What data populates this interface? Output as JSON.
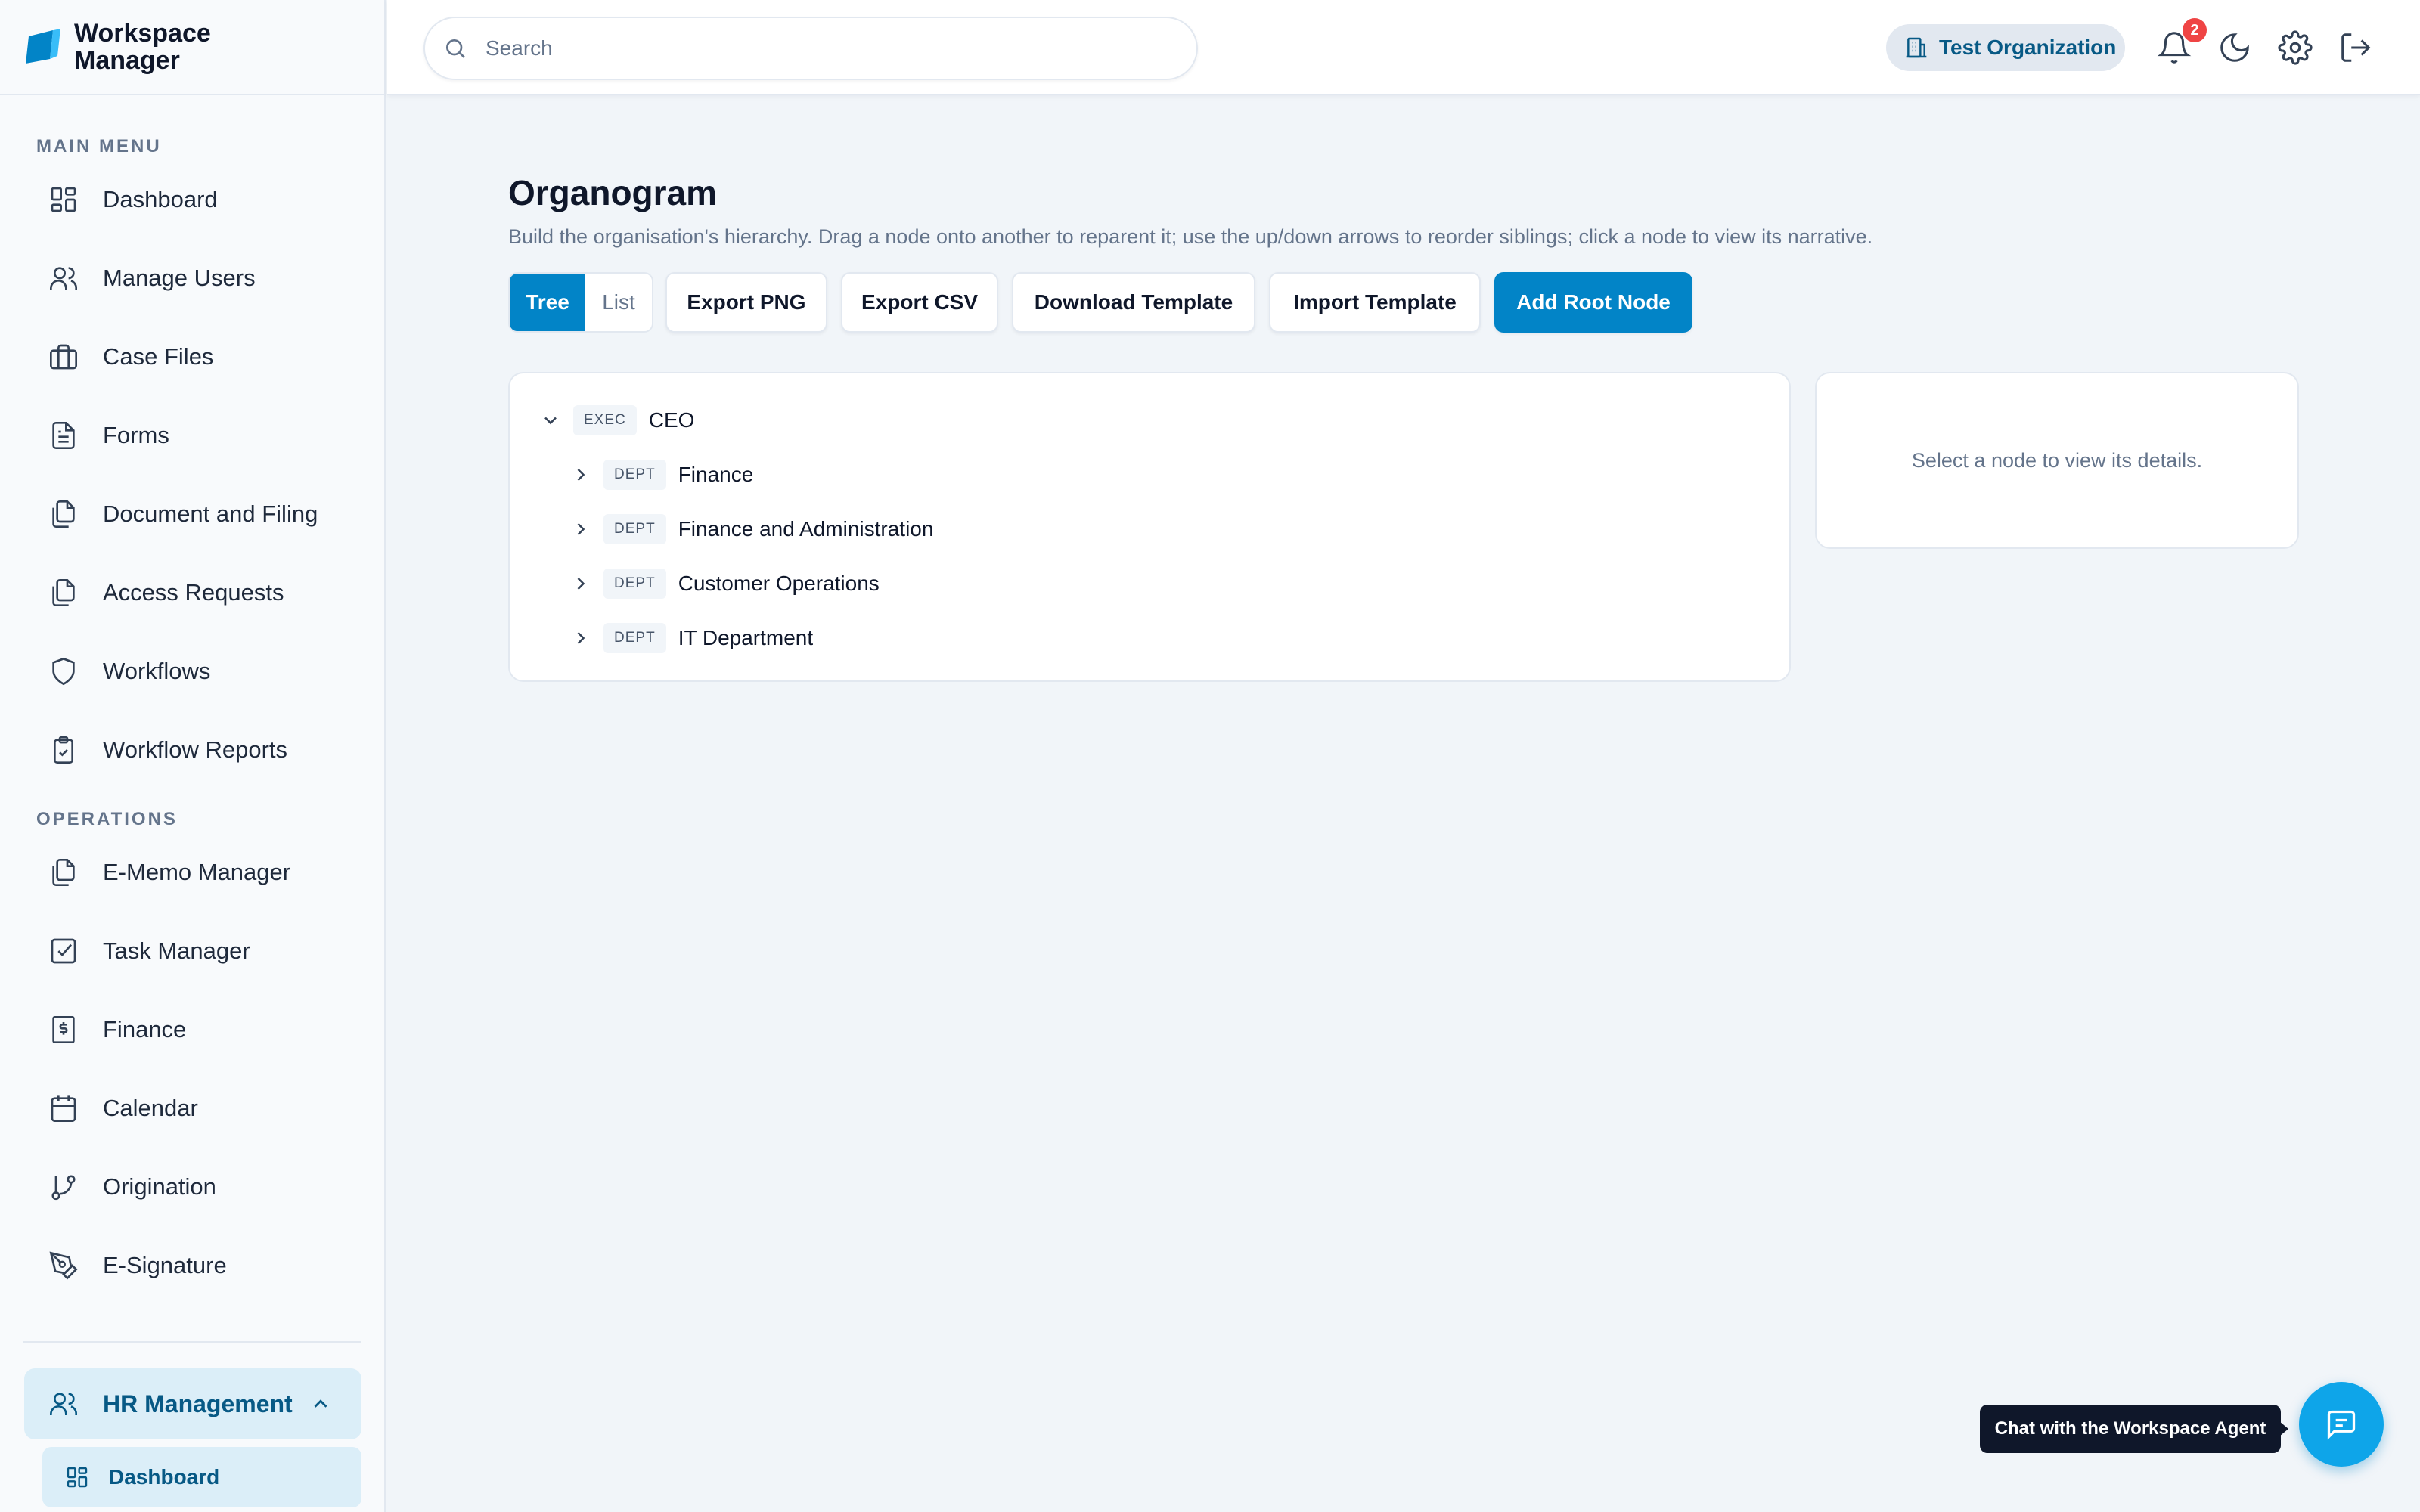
{
  "brand": {
    "line1": "Workspace",
    "line2": "Manager",
    "accent": "#0284c7"
  },
  "sidebar": {
    "main_label": "MAIN MENU",
    "main_items": [
      {
        "label": "Dashboard",
        "icon": "grid-icon"
      },
      {
        "label": "Manage Users",
        "icon": "users-icon"
      },
      {
        "label": "Case Files",
        "icon": "briefcase-icon"
      },
      {
        "label": "Forms",
        "icon": "file-text-icon"
      },
      {
        "label": "Document and Filing",
        "icon": "files-icon"
      },
      {
        "label": "Access Requests",
        "icon": "files-icon"
      },
      {
        "label": "Workflows",
        "icon": "shield-icon"
      },
      {
        "label": "Workflow Reports",
        "icon": "clipboard-check-icon"
      }
    ],
    "ops_label": "OPERATIONS",
    "ops_items": [
      {
        "label": "E-Memo Manager",
        "icon": "files-icon"
      },
      {
        "label": "Task Manager",
        "icon": "square-check-icon"
      },
      {
        "label": "Finance",
        "icon": "dollar-receipt-icon"
      },
      {
        "label": "Calendar",
        "icon": "calendar-icon"
      },
      {
        "label": "Origination",
        "icon": "git-branch-icon"
      },
      {
        "label": "E-Signature",
        "icon": "pen-tool-icon"
      }
    ],
    "hr_group": {
      "label": "HR Management",
      "icon": "users-icon"
    },
    "hr_sub": {
      "label": "Dashboard",
      "icon": "grid-icon"
    }
  },
  "header": {
    "search_placeholder": "Search",
    "org_name": "Test Organization",
    "notification_count": "2"
  },
  "main": {
    "title": "Organogram",
    "description": "Build the organisation's hierarchy. Drag a node onto another to reparent it; use the up/down arrows to reorder siblings; click a node to view its narrative.",
    "view_tree": "Tree",
    "view_list": "List",
    "export_png": "Export PNG",
    "export_csv": "Export CSV",
    "download_template": "Download Template",
    "import_template": "Import Template",
    "add_root": "Add Root Node",
    "tree": {
      "root": {
        "tag": "EXEC",
        "label": "CEO"
      },
      "children": [
        {
          "tag": "DEPT",
          "label": "Finance"
        },
        {
          "tag": "DEPT",
          "label": "Finance and Administration"
        },
        {
          "tag": "DEPT",
          "label": "Customer Operations"
        },
        {
          "tag": "DEPT",
          "label": "IT Department"
        }
      ]
    },
    "detail_empty": "Select a node to view its details."
  },
  "chat": {
    "tooltip": "Chat with the Workspace Agent"
  }
}
